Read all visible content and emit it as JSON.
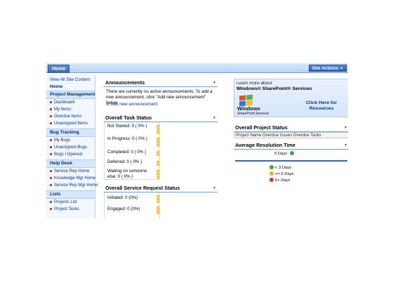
{
  "topbar": {
    "home_tab": "Home",
    "site_actions": "Site Actions"
  },
  "sidebar": {
    "view_all": "View All Site Content",
    "home": "Home",
    "sections": [
      {
        "title": "Project Management",
        "items": [
          "Dashboard",
          "My Items",
          "Overdue Items",
          "Unassigned Items"
        ]
      },
      {
        "title": "Bug Tracking",
        "items": [
          "My Bugs",
          "Unassigned Bugs",
          "Bugs I Opened"
        ]
      },
      {
        "title": "Help Desk",
        "items": [
          "Service Rep Home",
          "Knowledge Mgr Home",
          "Service Rep Mgr Home"
        ]
      },
      {
        "title": "Lists",
        "items": [
          "Projects List",
          "Project Tasks"
        ]
      }
    ]
  },
  "announcements": {
    "title": "Announcements",
    "empty_text": "There are currently no active announcements. To add a new announcement, click \"Add new announcement\" below.",
    "add_link": "Add new announcement"
  },
  "task_status": {
    "title": "Overall Task Status",
    "rows": [
      "Not Started: 0 ( 0% )",
      "In Progress: 0 ( 0% )",
      "Completed: 0 ( 0% )",
      "Deferred: 0 ( 0% )",
      "Waiting on someone else: 0 ( 0% )"
    ]
  },
  "service_status": {
    "title": "Overall Service Request Status",
    "rows": [
      "Initiated: 0 (0%)",
      "Engaged: 0 (0%)"
    ]
  },
  "promo": {
    "learn_more": "Learn more about",
    "product": "Windows® SharePoint® Services",
    "logo_line1": "Windows",
    "logo_line2": "SharePoint Services",
    "click_here": "Click Here for Resources"
  },
  "project_status": {
    "title": "Overall Project Status",
    "columns": "Project Name Overdue Issues Overdue Tasks"
  },
  "resolution": {
    "title": "Average Resolution Time",
    "days": "0 Days",
    "legend": [
      "< 3 Days",
      "<= 5 Days",
      "5+ Days"
    ]
  },
  "colors": {
    "accent": "#6f9dd9",
    "link": "#003399",
    "green": "#3fa63a",
    "yellow": "#e2b322",
    "red": "#d23b1e"
  }
}
